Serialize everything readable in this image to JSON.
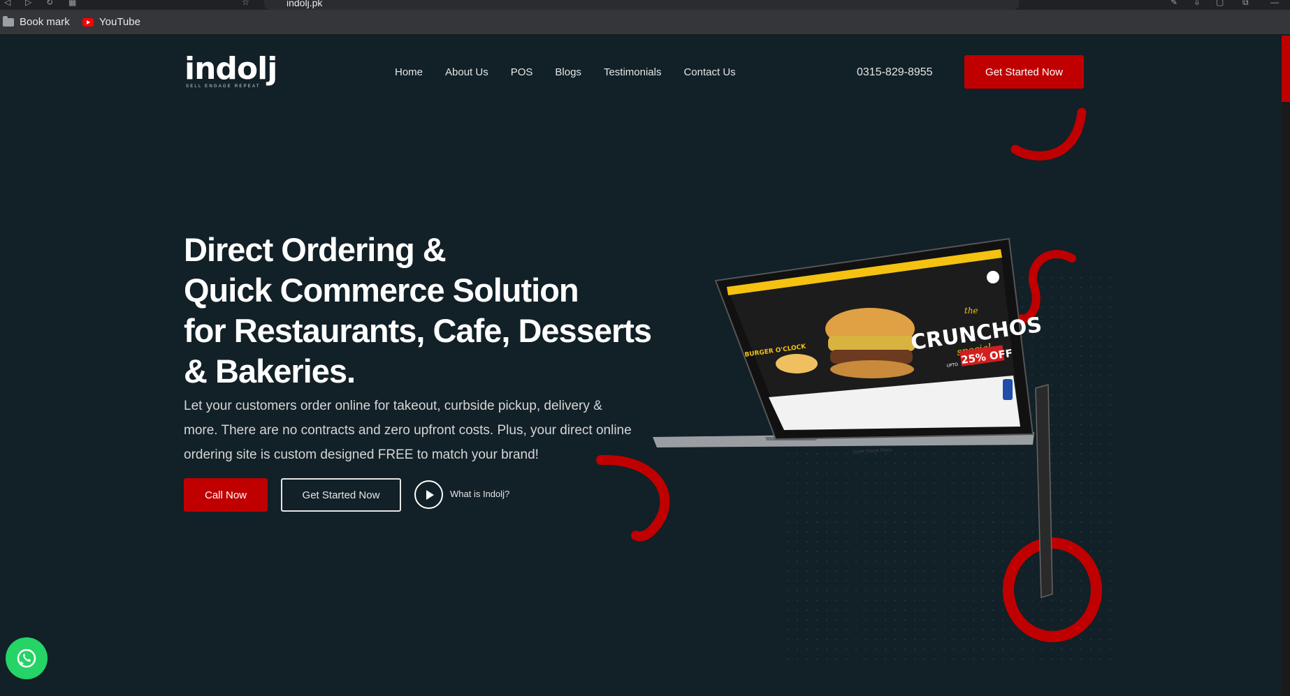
{
  "browser": {
    "url": "indolj.pk",
    "bookmarks": [
      {
        "label": "Book mark",
        "icon": "folder-icon"
      },
      {
        "label": "YouTube",
        "icon": "youtube-icon"
      }
    ]
  },
  "header": {
    "logo_text": "indolj",
    "logo_tagline": "SELL ENGAGE REPEAT",
    "nav": [
      "Home",
      "About Us",
      "POS",
      "Blogs",
      "Testimonials",
      "Contact Us"
    ],
    "phone": "0315-829-8955",
    "cta": "Get Started Now"
  },
  "hero": {
    "title_lines": [
      "Direct Ordering &",
      "Quick Commerce Solution",
      "for Restaurants, Cafe, Desserts",
      "& Bakeries."
    ],
    "subtitle": "Let your customers order online for takeout, curbside pickup, delivery & more. There are no contracts and zero upfront costs. Plus, your direct online ordering site is custom designed FREE to match your brand!",
    "call_button": "Call Now",
    "start_button": "Get Started Now",
    "video_link": "What is Indolj?"
  },
  "mockup": {
    "brand": "BURGER O'CLOCK",
    "promo_heading": "CRUNCHOS",
    "promo_script": "special",
    "promo_the": "the",
    "promo_offer": "25% OFF",
    "promo_upto": "UPTO",
    "footer_text": "Super Sauce Deals"
  },
  "colors": {
    "background": "#122027",
    "accent": "#c00000",
    "whatsapp": "#25d366"
  }
}
